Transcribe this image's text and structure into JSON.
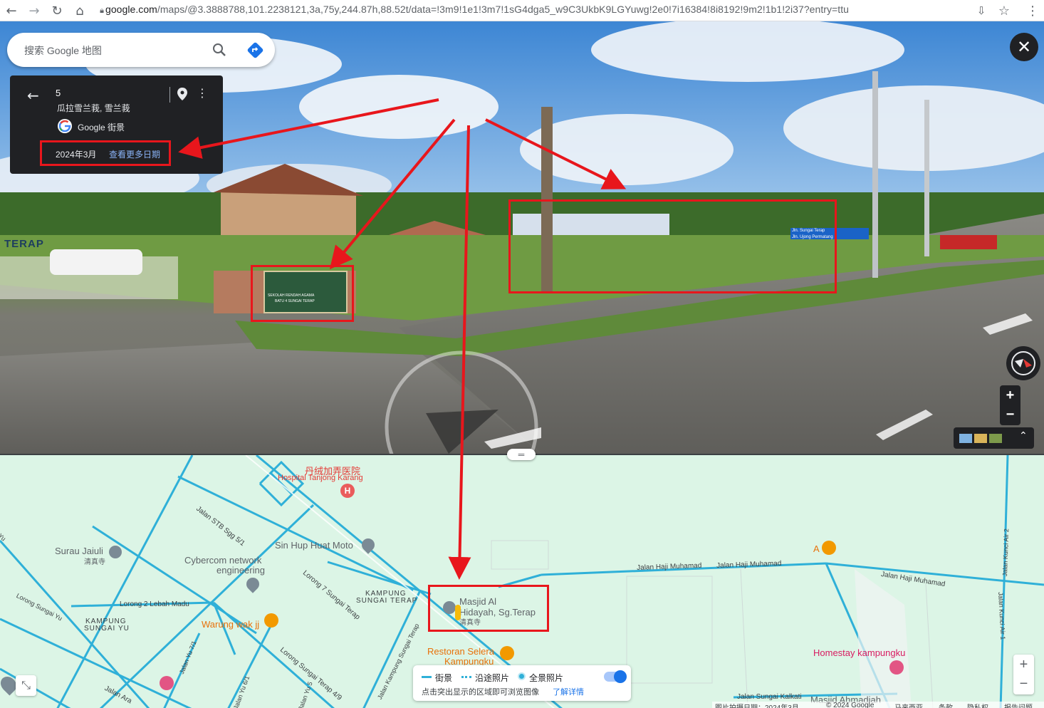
{
  "browser": {
    "url_host": "google.com",
    "url_path": "/maps/@3.3888788,101.2238121,3a,75y,244.87h,88.52t/data=!3m9!1e1!3m7!1sG4dga5_w9C3UkbK9LGYuwg!2e0!7i16384!8i8192!9m2!1b1!2i37?entry=ttu"
  },
  "search": {
    "placeholder": "搜索 Google 地图"
  },
  "infocard": {
    "title": "5",
    "subtitle": "瓜拉雪兰莪, 雪兰莪",
    "provider": "Google 街景",
    "date": "2024年3月",
    "more_dates": "查看更多日期"
  },
  "pano_signs": {
    "left_sign": "TERAP",
    "school_sign_line1": "SEKOLAH RENDAH AGAMA",
    "school_sign_line2": "BATU 4 SUNGAI TERAP",
    "road_sign_1": "Jln. Sungai Terap",
    "road_sign_2": "Jln. Ujong Permatang"
  },
  "map": {
    "hospital_cn": "丹绒加弄医院",
    "hospital_en": "Hospital Tanjong Karang",
    "surau": "Surau Jaiuli",
    "surau_sub": "清真寺",
    "sinhup": "Sin Hup Huat Moto",
    "cybercom1": "Cybercom network",
    "cybercom2": "engineering",
    "kampung_terap1": "KAMPUNG",
    "kampung_terap2": "SUNGAI TERAP",
    "kampung_yu1": "KAMPUNG",
    "kampung_yu2": "SUNGAI YU",
    "warung": "Warung wak jj",
    "masjid1": "Masjid Al",
    "masjid2": "Hidayah, Sg.Terap",
    "masjid_sub": "清真寺",
    "restoran1": "Restoran Selera",
    "restoran2": "Kampungku",
    "homestay": "Homestay kampungku",
    "masjid_ahmad": "Masjid Ahmadiah",
    "a_label": "A",
    "roads": {
      "stb": "Jalan STB Sgg 5/1",
      "lorong7": "Lorong 7 Sungai Terap",
      "lebah": "Lorong 2 Lebah Madu",
      "sgyu": "Lorong Sungai Yu",
      "yu": "Yu",
      "haji1": "Jalan Haji Muhamad",
      "haji2": "Jalan Haji Muhamad",
      "haji3": "Jalan Haji Muhamad",
      "kunci1": "Jalan Kunci Air 2",
      "kunci2": "Jalan Kunci Air 1",
      "yu1": "Jalan Yu 7/1",
      "yu6": "Jalan Yu 6/1",
      "yu5": "Jalan Yu 5",
      "ara": "Jalan Ara",
      "kampung": "Jalan Kampung Sungai Terap",
      "lorong49": "Lorong Sungai Terap 4/9",
      "kalkati": "Jalan Sungai Kalkati"
    }
  },
  "legend": {
    "streetview": "街景",
    "route_photos": "沿途照片",
    "panorama": "全景照片",
    "hint": "点击突出显示的区域即可浏览图像",
    "learn_more": "了解详情"
  },
  "footer": {
    "capture_date": "图片拍摄日期：2024年3月",
    "copyright": "© 2024 Google",
    "country": "马来西亚",
    "terms": "条款",
    "privacy": "隐私权",
    "report": "报告问题"
  },
  "colors": {
    "annotation_red": "#e8161c",
    "road_blue": "#2fb0d8",
    "map_bg": "#dcf5e6",
    "card_bg": "#202124",
    "link_blue": "#8ab4f8"
  }
}
